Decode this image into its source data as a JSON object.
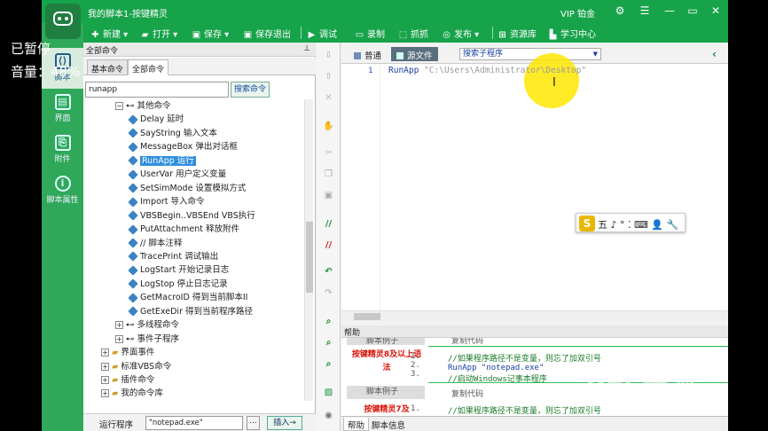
{
  "window": {
    "title": "我的脚本1-按键精灵",
    "vip": "VIP 铂金"
  },
  "toolbar": {
    "new": "新建",
    "open": "打开",
    "save": "保存",
    "save_exit": "保存退出",
    "debug": "调试",
    "record": "录制",
    "capture": "抓抓",
    "publish": "发布",
    "resource": "资源库",
    "learn": "学习中心"
  },
  "nav": {
    "script": "脚本",
    "ui": "界面",
    "attachment": "附件",
    "props": "脚本属性"
  },
  "overlay": {
    "paused": "已暂停",
    "volume": "音量：48%"
  },
  "left_panel": {
    "header": "全部命令",
    "tabs": [
      "基本命令",
      "全部命令"
    ],
    "search_value": "runapp",
    "search_button": "搜索命令",
    "tree": [
      {
        "label": "其他命令",
        "level": 0,
        "expanded": true
      },
      {
        "label": "Delay 延时",
        "level": 1
      },
      {
        "label": "SayString 输入文本",
        "level": 1
      },
      {
        "label": "MessageBox 弹出对话框",
        "level": 1
      },
      {
        "label": "RunApp 运行",
        "level": 1,
        "selected": true
      },
      {
        "label": "UserVar 用户定义变量",
        "level": 1
      },
      {
        "label": "SetSimMode 设置模拟方式",
        "level": 1
      },
      {
        "label": "Import 导入命令",
        "level": 1
      },
      {
        "label": "VBSBegin..VBSEnd VBS执行",
        "level": 1
      },
      {
        "label": "PutAttachment 释放附件",
        "level": 1
      },
      {
        "label": "// 脚本注释",
        "level": 1
      },
      {
        "label": "TracePrint 调试输出",
        "level": 1
      },
      {
        "label": "LogStart 开始记录日志",
        "level": 1
      },
      {
        "label": "LogStop 停止日志记录",
        "level": 1
      },
      {
        "label": "GetMacroID 得到当前脚本II",
        "level": 1
      },
      {
        "label": "GetExeDir 得到当前程序路径",
        "level": 1
      },
      {
        "label": "多线程命令",
        "level": 0,
        "expanded": false
      },
      {
        "label": "事件子程序",
        "level": 0,
        "expanded": false
      },
      {
        "label": "界面事件",
        "level": -1,
        "expanded": false
      },
      {
        "label": "标准VBS命令",
        "level": -1,
        "expanded": false
      },
      {
        "label": "插件命令",
        "level": -1,
        "expanded": false
      },
      {
        "label": "我的命令库",
        "level": -1,
        "expanded": false
      }
    ],
    "run_label": "运行程序",
    "run_value": "\"notepad.exe\"",
    "run_browse": "...",
    "insert_button": "插入→"
  },
  "editor": {
    "tabs": [
      "普通",
      "源文件"
    ],
    "scope": "搜索子程序",
    "line_number": "1",
    "code_func": "RunApp",
    "code_str": "\"C:\\Users\\Administrator\\Desktop\""
  },
  "ime": {
    "logo": "S",
    "text": "五 ♪ ° ⁚ ⌨ 👤 🔧"
  },
  "help": {
    "title": "帮助",
    "rows": [
      {
        "label": "脚本例子",
        "heading": "复制代码"
      },
      {
        "label": "按键精灵8及以上语法",
        "lines": [
          "1.",
          "2.",
          "3."
        ],
        "code": [
          "//如果程序路径不是变量，则忘了加双引号",
          "RunApp \"notepad.exe\"",
          "//启动Windows记事本程序"
        ]
      },
      {
        "label": "脚本例子",
        "heading": "复制代码"
      },
      {
        "label": "按键精灵7及",
        "lines": [
          "1."
        ],
        "code": [
          "//如果程序路径不是变量，则忘了加双引号"
        ]
      }
    ]
  },
  "bottom_tabs": [
    "帮助",
    "脚本信息"
  ],
  "watermark": {
    "main": "Bai 经验",
    "sub": "jingyan.baidu.com"
  },
  "colors": {
    "brand_green": "#17a34a",
    "selection": "#2f8fe0",
    "red": "#d9140a"
  }
}
